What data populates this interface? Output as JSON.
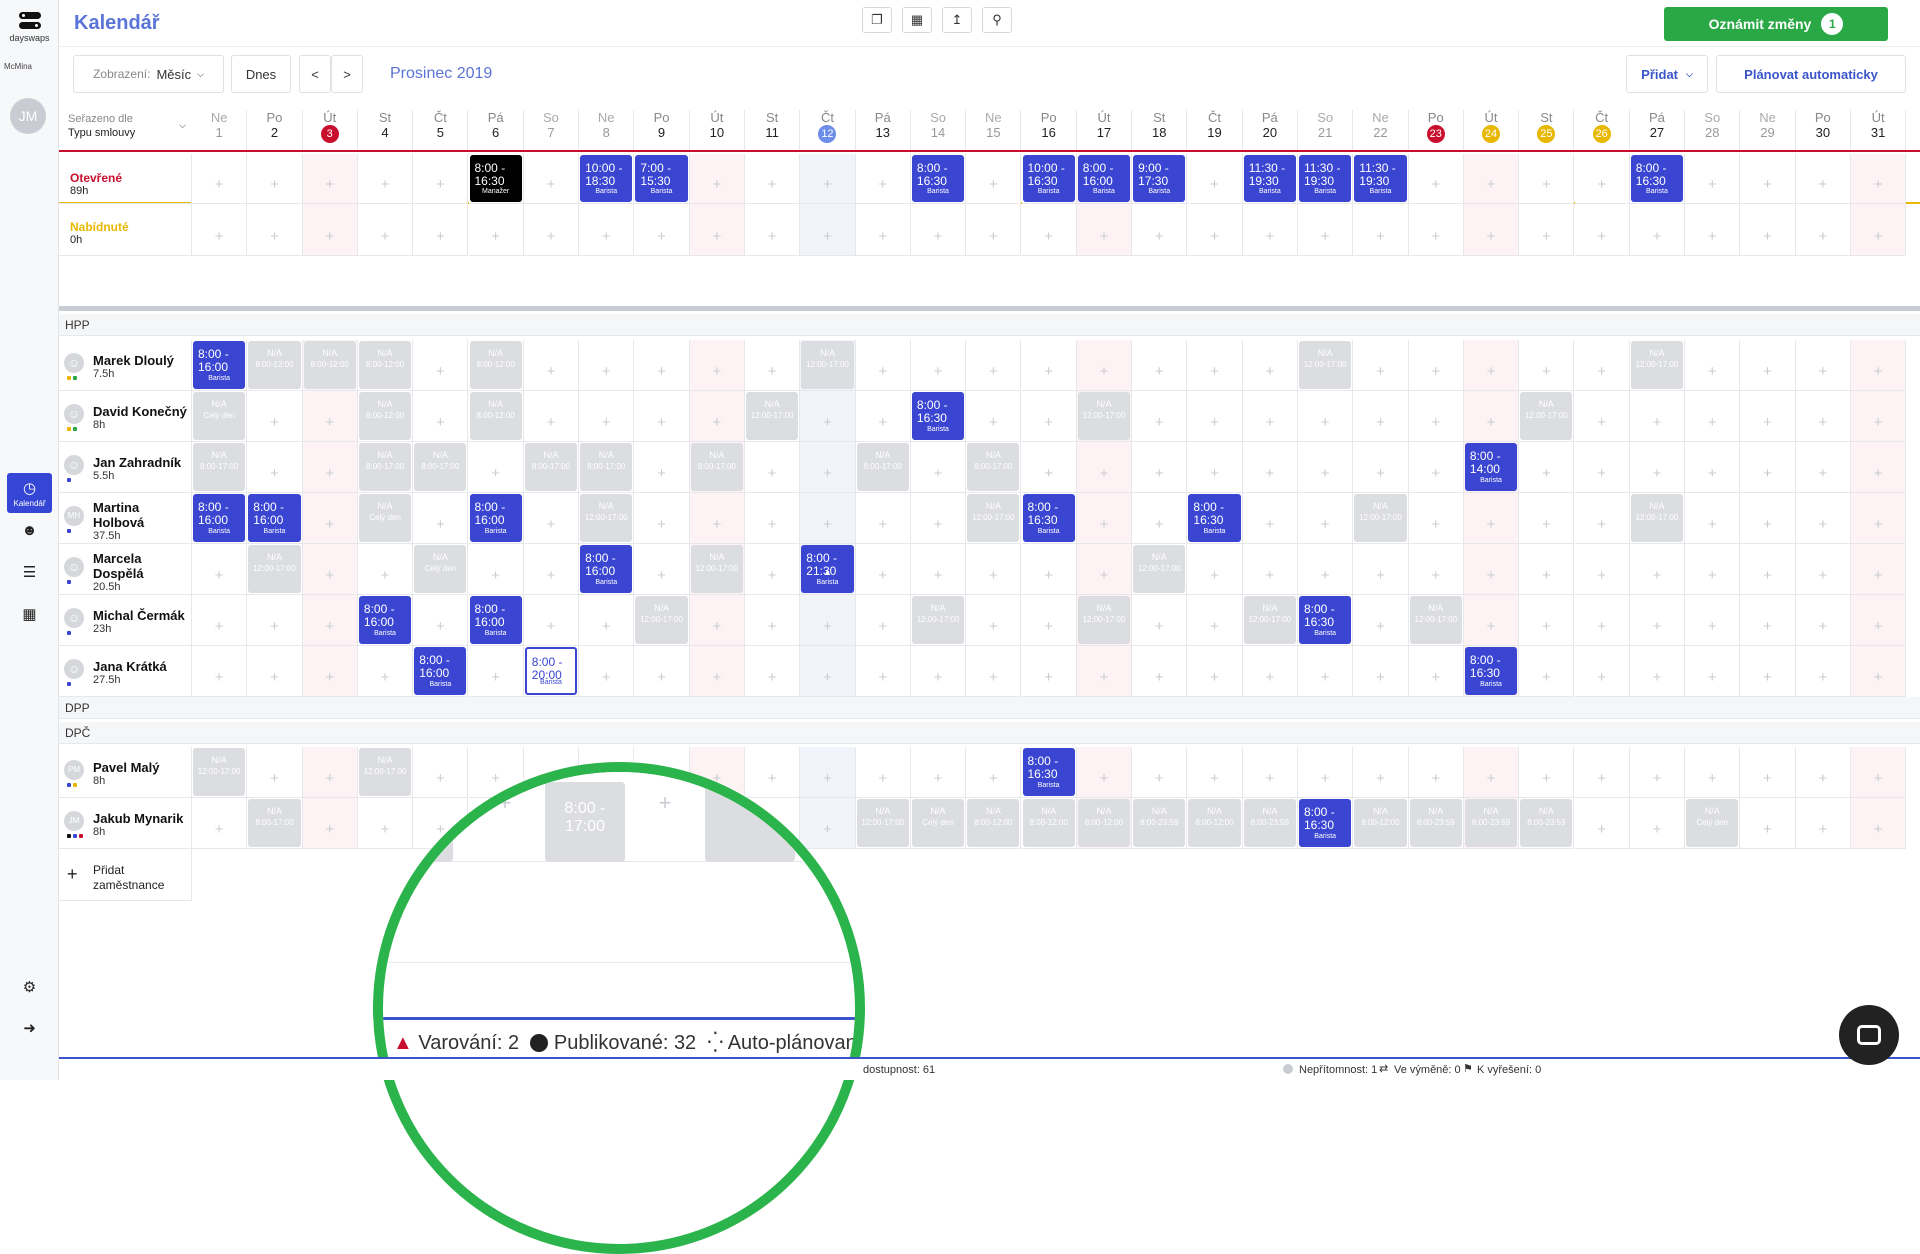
{
  "app": {
    "title": "Kalendář",
    "logo_text": "dayswaps",
    "company": "McMina",
    "user_initials": "JM"
  },
  "sidebar": {
    "calendar_label": "Kalendář"
  },
  "header": {
    "announce_label": "Oznámit změny",
    "announce_count": "1"
  },
  "toolbar": {
    "view_label": "Zobrazení:",
    "view_value": "Měsíc",
    "today": "Dnes",
    "prev": "<",
    "next": ">",
    "month": "Prosinec 2019",
    "add": "Přidat",
    "auto_plan": "Plánovat automaticky"
  },
  "sort": {
    "label": "Seřazeno dle",
    "value": "Typu smlouvy"
  },
  "days": [
    {
      "d": "Ne",
      "n": "1"
    },
    {
      "d": "Po",
      "n": "2"
    },
    {
      "d": "Út",
      "n": "3",
      "badge": "#c8102e"
    },
    {
      "d": "St",
      "n": "4"
    },
    {
      "d": "Čt",
      "n": "5"
    },
    {
      "d": "Pá",
      "n": "6"
    },
    {
      "d": "So",
      "n": "7"
    },
    {
      "d": "Ne",
      "n": "8"
    },
    {
      "d": "Po",
      "n": "9"
    },
    {
      "d": "Út",
      "n": "10"
    },
    {
      "d": "St",
      "n": "11"
    },
    {
      "d": "Čt",
      "n": "12",
      "badge": "#6d8ee8"
    },
    {
      "d": "Pá",
      "n": "13"
    },
    {
      "d": "So",
      "n": "14"
    },
    {
      "d": "Ne",
      "n": "15"
    },
    {
      "d": "Po",
      "n": "16"
    },
    {
      "d": "Út",
      "n": "17"
    },
    {
      "d": "St",
      "n": "18"
    },
    {
      "d": "Čt",
      "n": "19"
    },
    {
      "d": "Pá",
      "n": "20"
    },
    {
      "d": "So",
      "n": "21"
    },
    {
      "d": "Ne",
      "n": "22"
    },
    {
      "d": "Po",
      "n": "23",
      "badge": "#c8102e"
    },
    {
      "d": "Út",
      "n": "24",
      "badge": "#e8b800"
    },
    {
      "d": "St",
      "n": "25",
      "badge": "#e8b800"
    },
    {
      "d": "Čt",
      "n": "26",
      "badge": "#e8b800"
    },
    {
      "d": "Pá",
      "n": "27"
    },
    {
      "d": "So",
      "n": "28"
    },
    {
      "d": "Ne",
      "n": "29"
    },
    {
      "d": "Po",
      "n": "30"
    },
    {
      "d": "Út",
      "n": "31"
    }
  ],
  "open_row": {
    "label": "Otevřené",
    "hours": "89h",
    "shifts": [
      {
        "day": 6,
        "time": "8:00 - 16:30",
        "role": "Manažer",
        "style": "black"
      },
      {
        "day": 8,
        "time": "10:00 - 18:30",
        "role": "Barista"
      },
      {
        "day": 9,
        "time": "7:00 - 15:30",
        "role": "Barista"
      },
      {
        "day": 14,
        "time": "8:00 - 16:30",
        "role": "Barista"
      },
      {
        "day": 16,
        "time": "10:00 - 16:30",
        "role": "Barista"
      },
      {
        "day": 17,
        "time": "8:00 - 16:00",
        "role": "Barista"
      },
      {
        "day": 18,
        "time": "9:00 - 17:30",
        "role": "Barista"
      },
      {
        "day": 20,
        "time": "11:30 - 19:30",
        "role": "Barista"
      },
      {
        "day": 21,
        "time": "11:30 - 19:30",
        "role": "Barista"
      },
      {
        "day": 22,
        "time": "11:30 - 19:30",
        "role": "Barista"
      },
      {
        "day": 27,
        "time": "8:00 - 16:30",
        "role": "Barista"
      }
    ]
  },
  "offered_row": {
    "label": "Nabídnuté",
    "hours": "0h"
  },
  "sections": {
    "hpp": "HPP",
    "dpp": "DPP",
    "dpc": "DPČ"
  },
  "employees": [
    {
      "name": "Marek Dloulý",
      "hours": "7.5h",
      "avatar": "",
      "dots": [
        "#e8b800",
        "#2aa845"
      ],
      "shifts": [
        {
          "day": 1,
          "time": "8:00 - 16:00",
          "role": "Barista"
        }
      ],
      "na": [
        {
          "day": 2,
          "t": "N/A",
          "s": "8:00-12:00"
        },
        {
          "day": 3,
          "t": "N/A",
          "s": "8:00-12:00"
        },
        {
          "day": 4,
          "t": "N/A",
          "s": "8:00-12:00"
        },
        {
          "day": 6,
          "t": "N/A",
          "s": "8:00-12:00"
        },
        {
          "day": 12,
          "t": "N/A",
          "s": "12:00-17:00"
        },
        {
          "day": 21,
          "t": "N/A",
          "s": "12:00-17:00"
        },
        {
          "day": 27,
          "t": "N/A",
          "s": "12:00-17:00"
        }
      ]
    },
    {
      "name": "David Konečný",
      "hours": "8h",
      "avatar": "",
      "dots": [
        "#e8b800",
        "#2aa845"
      ],
      "shifts": [
        {
          "day": 14,
          "time": "8:00 - 16:30",
          "role": "Barista"
        }
      ],
      "na": [
        {
          "day": 1,
          "t": "N/A",
          "s": "Celý den"
        },
        {
          "day": 4,
          "t": "N/A",
          "s": "8:00-12:00"
        },
        {
          "day": 6,
          "t": "N/A",
          "s": "8:00-12:00"
        },
        {
          "day": 11,
          "t": "N/A",
          "s": "12:00-17:00"
        },
        {
          "day": 17,
          "t": "N/A",
          "s": "12:00-17:00"
        },
        {
          "day": 25,
          "t": "N/A",
          "s": "12:00-17:00"
        }
      ]
    },
    {
      "name": "Jan Zahradník",
      "hours": "5.5h",
      "avatar": "",
      "dots": [
        "#3a46d1"
      ],
      "shifts": [
        {
          "day": 24,
          "time": "8:00 - 14:00",
          "role": "Barista"
        }
      ],
      "na": [
        {
          "day": 1,
          "t": "N/A",
          "s": "8:00-17:00"
        },
        {
          "day": 4,
          "t": "N/A",
          "s": "8:00-17:00"
        },
        {
          "day": 5,
          "t": "N/A",
          "s": "8:00-17:00"
        },
        {
          "day": 7,
          "t": "N/A",
          "s": "8:00-17:00"
        },
        {
          "day": 8,
          "t": "N/A",
          "s": "8:00-17:00"
        },
        {
          "day": 10,
          "t": "N/A",
          "s": "8:00-17:00"
        },
        {
          "day": 13,
          "t": "N/A",
          "s": "8:00-17:00"
        },
        {
          "day": 15,
          "t": "N/A",
          "s": "8:00-17:00"
        }
      ]
    },
    {
      "name": "Martina Holbová",
      "hours": "37.5h",
      "avatar": "MH",
      "dots": [
        "#3a46d1"
      ],
      "shifts": [
        {
          "day": 1,
          "time": "8:00 - 16:00",
          "role": "Barista"
        },
        {
          "day": 2,
          "time": "8:00 - 16:00",
          "role": "Barista"
        },
        {
          "day": 6,
          "time": "8:00 - 16:00",
          "role": "Barista"
        },
        {
          "day": 16,
          "time": "8:00 - 16:30",
          "role": "Barista"
        },
        {
          "day": 19,
          "time": "8:00 - 16:30",
          "role": "Barista"
        }
      ],
      "na": [
        {
          "day": 4,
          "t": "N/A",
          "s": "Celý den"
        },
        {
          "day": 8,
          "t": "N/A",
          "s": "12:00-17:00"
        },
        {
          "day": 15,
          "t": "N/A",
          "s": "12:00-17:00"
        },
        {
          "day": 22,
          "t": "N/A",
          "s": "12:00-17:00"
        },
        {
          "day": 27,
          "t": "N/A",
          "s": "12:00-17:00"
        }
      ]
    },
    {
      "name": "Marcela Dospělá",
      "hours": "20.5h",
      "avatar": "",
      "dots": [
        "#3a46d1"
      ],
      "shifts": [
        {
          "day": 8,
          "time": "8:00 - 16:00",
          "role": "Barista"
        },
        {
          "day": 12,
          "time": "8:00 - 21:30",
          "role": "Barista",
          "warn": true
        }
      ],
      "na": [
        {
          "day": 2,
          "t": "N/A",
          "s": "12:00-17:00"
        },
        {
          "day": 5,
          "t": "N/A",
          "s": "Celý den"
        },
        {
          "day": 10,
          "t": "N/A",
          "s": "12:00-17:00"
        },
        {
          "day": 18,
          "t": "N/A",
          "s": "12:00-17:00"
        }
      ]
    },
    {
      "name": "Michal Čermák",
      "hours": "23h",
      "avatar": "",
      "dots": [
        "#3a46d1"
      ],
      "shifts": [
        {
          "day": 4,
          "time": "8:00 - 16:00",
          "role": "Barista"
        },
        {
          "day": 6,
          "time": "8:00 - 16:00",
          "role": "Barista"
        },
        {
          "day": 21,
          "time": "8:00 - 16:30",
          "role": "Barista"
        }
      ],
      "na": [
        {
          "day": 9,
          "t": "N/A",
          "s": "12:00-17:00"
        },
        {
          "day": 14,
          "t": "N/A",
          "s": "12:00-17:00"
        },
        {
          "day": 17,
          "t": "N/A",
          "s": "12:00-17:00"
        },
        {
          "day": 20,
          "t": "N/A",
          "s": "12:00-17:00"
        },
        {
          "day": 23,
          "t": "N/A",
          "s": "12:00-17:00"
        }
      ]
    },
    {
      "name": "Jana Krátká",
      "hours": "27.5h",
      "avatar": "",
      "dots": [
        "#3a46d1"
      ],
      "shifts": [
        {
          "day": 5,
          "time": "8:00 - 16:00",
          "role": "Barista"
        },
        {
          "day": 7,
          "time": "8:00 - 20:00",
          "role": "Barista",
          "style": "outline"
        },
        {
          "day": 24,
          "time": "8:00 - 16:30",
          "role": "Barista"
        }
      ],
      "na": []
    }
  ],
  "dpc_employees": [
    {
      "name": "Pavel Malý",
      "hours": "8h",
      "avatar": "PM",
      "dots": [
        "#3a46d1",
        "#e8b800"
      ],
      "shifts": [
        {
          "day": 16,
          "time": "8:00 - 16:30",
          "role": "Barista"
        }
      ],
      "na": [
        {
          "day": 1,
          "t": "N/A",
          "s": "12:00-17:00"
        },
        {
          "day": 4,
          "t": "N/A",
          "s": "12:00-17:00"
        }
      ]
    },
    {
      "name": "Jakub Mynarik",
      "hours": "8h",
      "avatar": "JM",
      "dots": [
        "#111",
        "#3a46d1",
        "#c8102e"
      ],
      "shifts": [
        {
          "day": 21,
          "time": "8:00 - 16:30",
          "role": "Barista"
        }
      ],
      "na": [
        {
          "day": 2,
          "t": "N/A",
          "s": "8:00-17:00"
        },
        {
          "day": 13,
          "t": "N/A",
          "s": "12:00-17:00"
        },
        {
          "day": 14,
          "t": "N/A",
          "s": "Celý den"
        },
        {
          "day": 15,
          "t": "N/A",
          "s": "8:00-12:00"
        },
        {
          "day": 16,
          "t": "N/A",
          "s": "8:00-12:00"
        },
        {
          "day": 17,
          "t": "N/A",
          "s": "8:00-12:00"
        },
        {
          "day": 18,
          "t": "N/A",
          "s": "8:00-23:59"
        },
        {
          "day": 19,
          "t": "N/A",
          "s": "8:00-12:00"
        },
        {
          "day": 20,
          "t": "N/A",
          "s": "8:00-23:59"
        },
        {
          "day": 22,
          "t": "N/A",
          "s": "8:00-12:00"
        },
        {
          "day": 23,
          "t": "N/A",
          "s": "8:00-23:59"
        },
        {
          "day": 24,
          "t": "N/A",
          "s": "8:00-23:59"
        },
        {
          "day": 25,
          "t": "N/A",
          "s": "8:00-23:59"
        },
        {
          "day": 28,
          "t": "N/A",
          "s": "Celý den"
        }
      ]
    }
  ],
  "add_employee": "Přidat zaměstnance",
  "zoom": {
    "shift_time": "8:00 - 17:00",
    "warn_label": "Varování: 2",
    "published_label": "Publikované: 32",
    "auto_label": "Auto-plánované:"
  },
  "status": {
    "availability": "dostupnost: 61",
    "absence": "Nepřítomnost: 1",
    "swap": "Ve výměně: 0",
    "resolve": "K vyřešení: 0"
  }
}
